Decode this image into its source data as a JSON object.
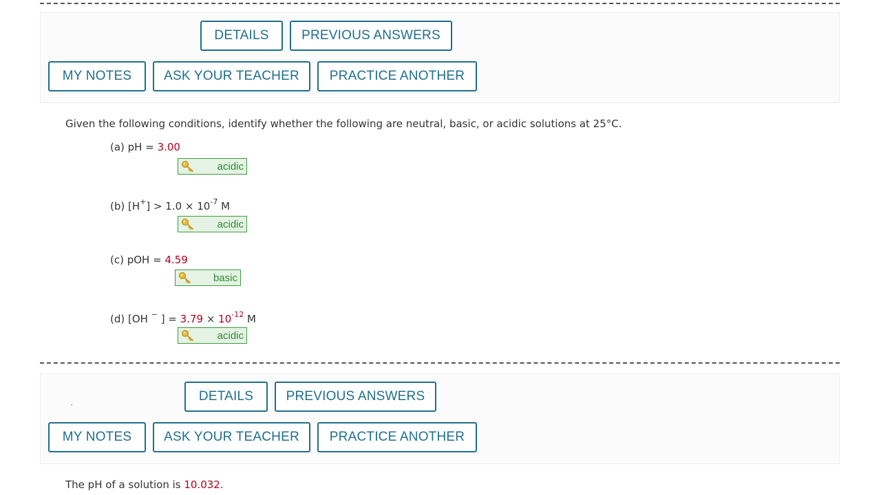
{
  "question1": {
    "buttons": {
      "details": "DETAILS",
      "previous_answers": "PREVIOUS ANSWERS",
      "my_notes": "MY NOTES",
      "ask_your_teacher": "ASK YOUR TEACHER",
      "practice_another": "PRACTICE ANOTHER"
    },
    "prompt": "Given the following conditions, identify whether the following are neutral, basic, or acidic solutions at 25°C.",
    "parts": [
      {
        "label": "(a) pH = ",
        "value": "3.00",
        "answer": "acidic"
      },
      {
        "label_prefix": "(b) [H",
        "label_sup": "+",
        "label_mid": "] > 1.0 × 10",
        "label_exp": "-7",
        "label_unit": " M",
        "answer": "acidic"
      },
      {
        "label": "(c) pOH = ",
        "value": "4.59",
        "answer": "basic"
      },
      {
        "label_prefix": "(d) [OH ",
        "label_sup": "−",
        "label_mid": " ] = ",
        "value": "3.79",
        "times": " × ",
        "base": "10",
        "exp": "-12",
        "unit": " M",
        "answer": "acidic"
      }
    ],
    "answer_icon": "key-icon",
    "colors": {
      "accent": "#1f6e8c",
      "value_red": "#b0001e",
      "answer_green": "#2e8a2e",
      "answer_bg": "#e4f3e4"
    }
  },
  "question2": {
    "buttons": {
      "details": "DETAILS",
      "previous_answers": "PREVIOUS ANSWERS",
      "my_notes": "MY NOTES",
      "ask_your_teacher": "ASK YOUR TEACHER",
      "practice_another": "PRACTICE ANOTHER"
    },
    "prompt_prefix": "The pH of a solution is ",
    "prompt_value": "10.032",
    "prompt_suffix": "."
  }
}
